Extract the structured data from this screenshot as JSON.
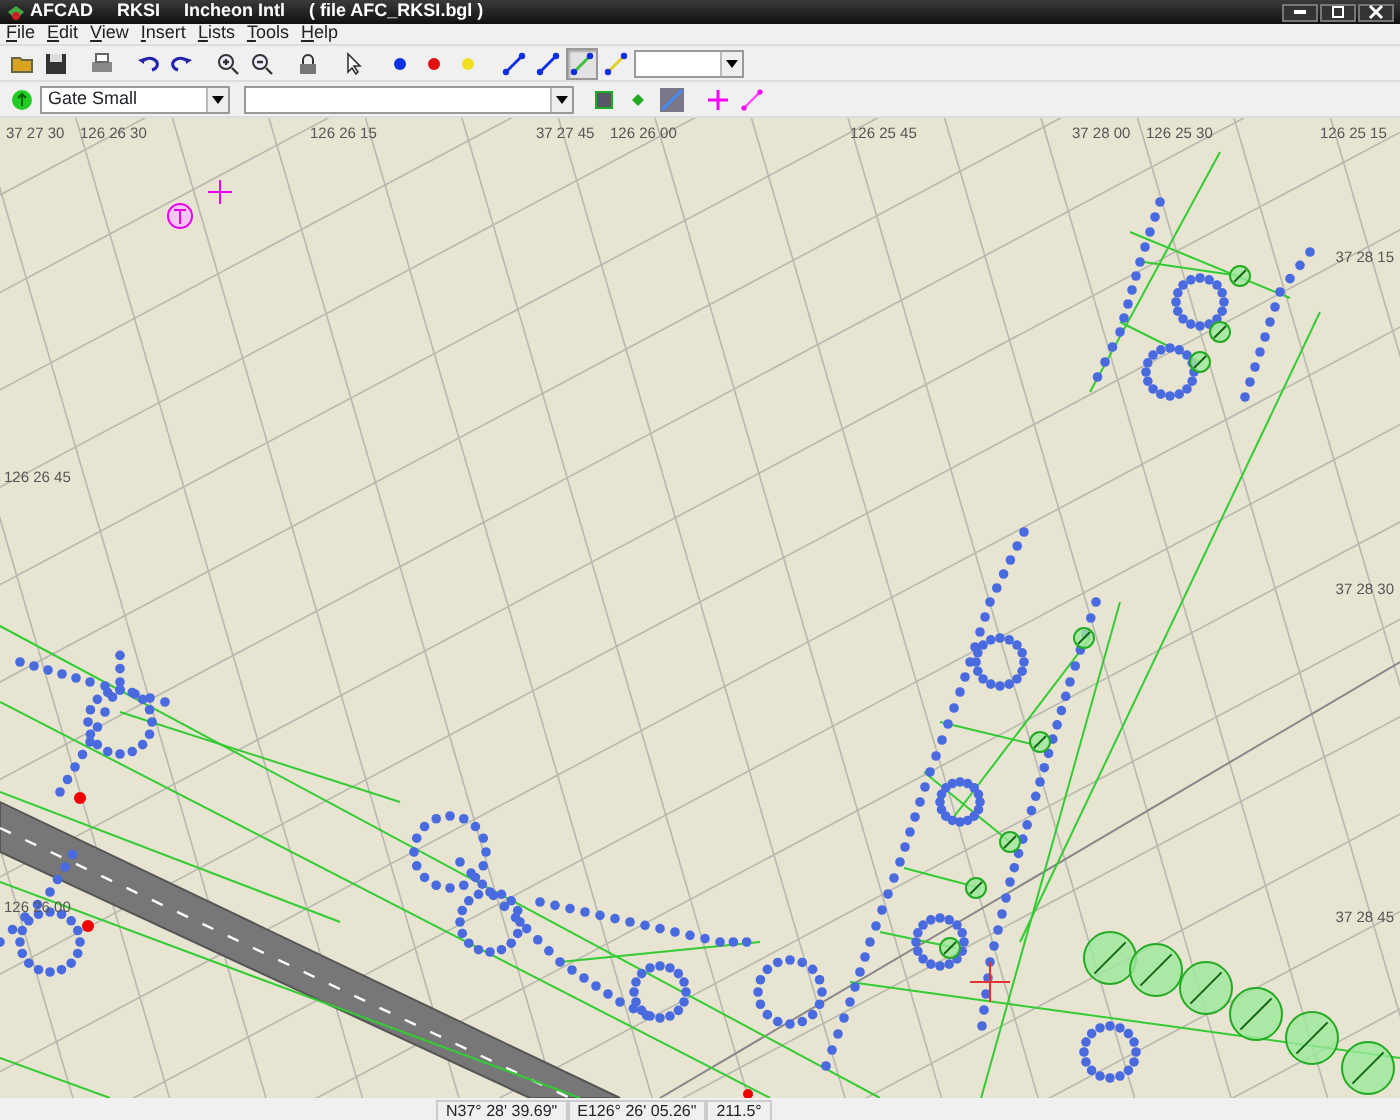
{
  "window": {
    "title_parts": [
      "AFCAD",
      "RKSI",
      "Incheon Intl",
      "( file AFC_RKSI.bgl )"
    ]
  },
  "menu": [
    "File",
    "Edit",
    "View",
    "Insert",
    "Lists",
    "Tools",
    "Help"
  ],
  "line_tools": [
    {
      "selected": false
    },
    {
      "selected": false
    },
    {
      "selected": true
    },
    {
      "selected": false
    }
  ],
  "object_type": {
    "value": "Gate Small"
  },
  "map": {
    "top_labels": [
      "37 27 30",
      "126 26 30",
      "126 26 15",
      "37 27 45",
      "126 26 00",
      "126 25 45",
      "37 28 00",
      "126 25 30",
      "126 25 15"
    ],
    "right_labels": [
      "37 28 15",
      "37 28 30",
      "37 28 45"
    ],
    "left_labels": [
      "126 26 45",
      "126 26 00"
    ]
  },
  "status_bar": [
    "N37° 28' 39.69\"",
    "E126° 26' 05.26\"",
    "211.5°"
  ]
}
